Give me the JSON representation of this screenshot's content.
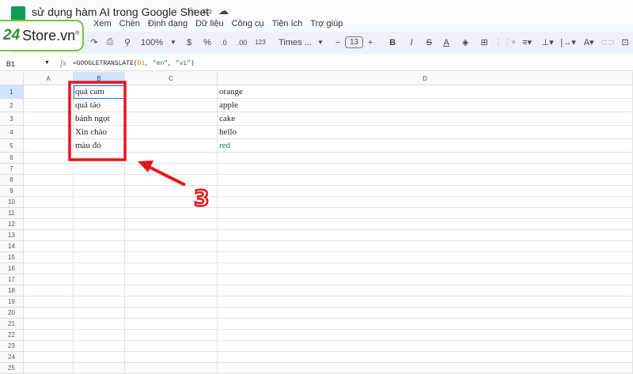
{
  "document": {
    "title": "sử dụng hàm AI trong Google Sheet"
  },
  "title_icons": [
    "star-icon",
    "folder-icon",
    "cloud-icon"
  ],
  "menu": [
    "Xem",
    "Chèn",
    "Định dạng",
    "Dữ liệu",
    "Công cụ",
    "Tiện ích",
    "Trợ giúp"
  ],
  "logo": {
    "number": "24",
    "name": "Store.vn®"
  },
  "toolbar": {
    "zoom": "100%",
    "currency": "$",
    "percent": "%",
    "dec_less": ".0",
    "dec_more": ".00",
    "format": "123",
    "font": "Times ...",
    "font_size": "13",
    "minus": "−",
    "plus": "+",
    "bold": "B",
    "italic": "I",
    "strike": "S",
    "text_color": "A"
  },
  "formula_bar": {
    "name_box": "B1",
    "fx": "fx",
    "formula": "=GOOGLETRANSLATE(D1, \"en\", \"vi\")"
  },
  "columns": [
    "A",
    "B",
    "C",
    "D"
  ],
  "rows": [
    "1",
    "2",
    "3",
    "4",
    "5",
    "6",
    "7",
    "8",
    "9",
    "10",
    "11",
    "12",
    "13",
    "14",
    "15",
    "16",
    "17",
    "18",
    "19",
    "20",
    "21",
    "22",
    "23",
    "24",
    "25"
  ],
  "cells": {
    "B": [
      "quả cam",
      "quả táo",
      "bánh ngọt",
      "Xin chào",
      "màu đỏ"
    ],
    "D": [
      "orange",
      "apple",
      "cake",
      "hello",
      "red"
    ]
  },
  "annotation": {
    "label": "3",
    "color": "#e8141b"
  },
  "colors": {
    "accent": "#1a73e8",
    "green_text": "#188038"
  }
}
